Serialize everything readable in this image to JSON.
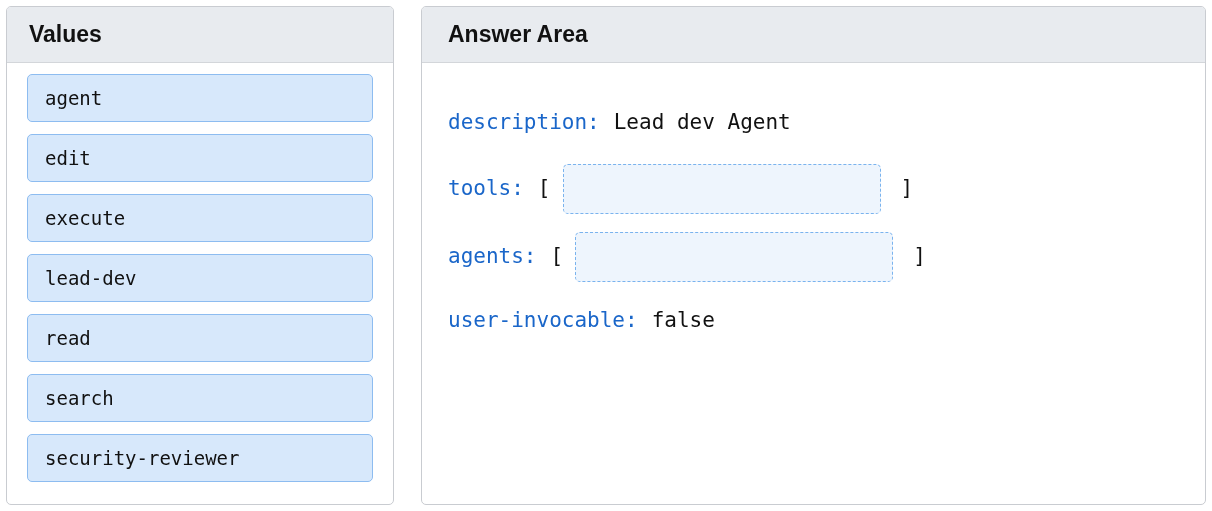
{
  "values_panel": {
    "title": "Values",
    "items": [
      "agent",
      "edit",
      "execute",
      "lead-dev",
      "read",
      "search",
      "security-reviewer"
    ]
  },
  "answer_panel": {
    "title": "Answer Area",
    "lines": [
      {
        "kind": "text",
        "key": "description:",
        "value": "Lead dev Agent"
      },
      {
        "kind": "drop",
        "key": "tools:",
        "open": "[",
        "close": "]"
      },
      {
        "kind": "drop",
        "key": "agents:",
        "open": "[",
        "close": "]"
      },
      {
        "kind": "text",
        "key": "user-invocable:",
        "value": "false"
      }
    ]
  }
}
